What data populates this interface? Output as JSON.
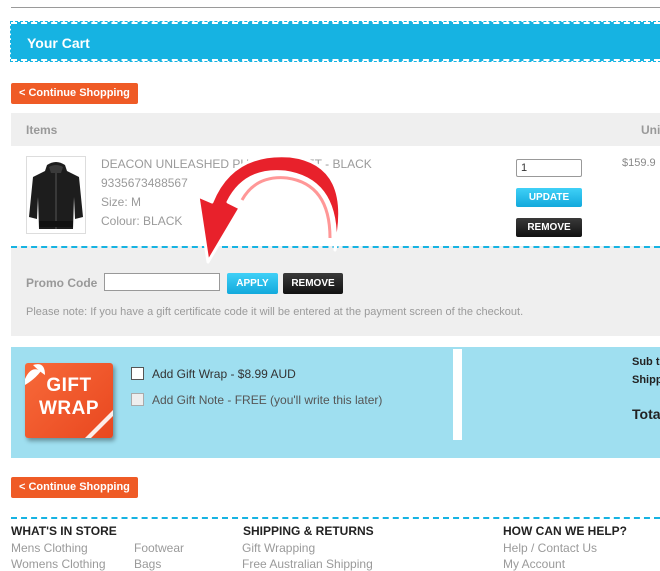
{
  "cart": {
    "title": "Your Cart"
  },
  "nav": {
    "continue_label": "< Continue Shopping",
    "continue_label_bottom": "< Continue Shopping"
  },
  "table": {
    "col_items": "Items",
    "col_unit": "Uni"
  },
  "product": {
    "name": "DEACON UNLEASHED PU",
    "name_end": "ACKET - BLACK",
    "sku": "9335673488567",
    "size": "Size: M",
    "colour": "Colour: BLACK",
    "qty": "1",
    "update_label": "UPDATE",
    "remove_label": "REMOVE",
    "price": "$159.9"
  },
  "promo": {
    "label": "Promo Code",
    "value": "",
    "apply_label": "APPLY",
    "remove_label": "REMOVE",
    "note": "Please note: If you have a gift certificate code it will be entered at the payment screen of the checkout."
  },
  "gift": {
    "badge_line1": "GIFT",
    "badge_line2": "WRAP",
    "wrap_label": "Add Gift Wrap - $8.99 AUD",
    "wrap_checked": false,
    "note_label": "Add Gift Note - FREE (you'll write this later)",
    "note_enabled": false
  },
  "totals": {
    "subtotal_label": "Sub t",
    "shipping_label": "Shipp",
    "total_label": "Tota"
  },
  "footer": {
    "col1_heading": "WHAT'S IN STORE",
    "col1_links": [
      "Mens Clothing",
      "Womens Clothing"
    ],
    "col1b_links": [
      "Footwear",
      "Bags"
    ],
    "col2_heading": "SHIPPING & RETURNS",
    "col2_links": [
      "Gift Wrapping",
      "Free Australian Shipping"
    ],
    "col3_heading": "HOW CAN WE HELP?",
    "col3_links": [
      "Help / Contact Us",
      "My Account"
    ]
  },
  "colors": {
    "accent": "#16b3e2",
    "orange": "#ef5b26",
    "arrow": "#e8212b",
    "gift_bg": "#9fdff0"
  }
}
